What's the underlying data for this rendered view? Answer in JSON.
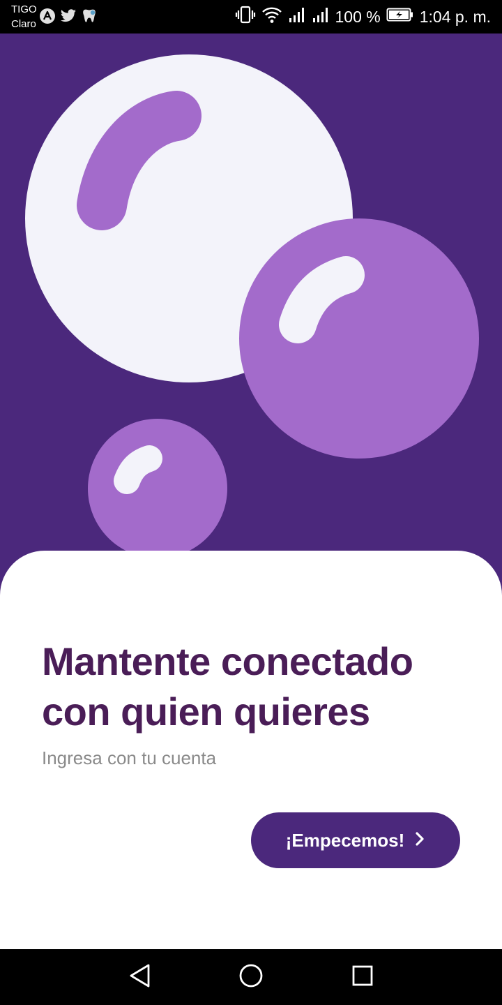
{
  "status_bar": {
    "carrier_1": "TIGO",
    "carrier_2": "Claro",
    "battery": "100 %",
    "time": "1:04 p. m.",
    "notification_icons": [
      "app-a-icon",
      "twitter-icon",
      "tooth-app-icon"
    ],
    "system_icons": [
      "vibrate-icon",
      "wifi-icon",
      "signal-icon",
      "signal-icon",
      "battery-charging-icon"
    ]
  },
  "hero": {
    "illustration": "bubbles",
    "colors": {
      "background": "#4b287c",
      "bubble_light": "#f3f3fa",
      "bubble_purple": "#a36bcb"
    }
  },
  "onboarding": {
    "title": "Mantente conectado con quien quieres",
    "subtitle": "Ingresa con tu cuenta",
    "start_button_label": "¡Empecemos!",
    "start_button_icon": "chevron-right-icon"
  },
  "nav_bar": {
    "buttons": [
      "back-icon",
      "home-icon",
      "recents-icon"
    ]
  },
  "colors": {
    "title": "#4a1d57",
    "subtitle": "#8a8a8a",
    "button": "#4b287c"
  }
}
